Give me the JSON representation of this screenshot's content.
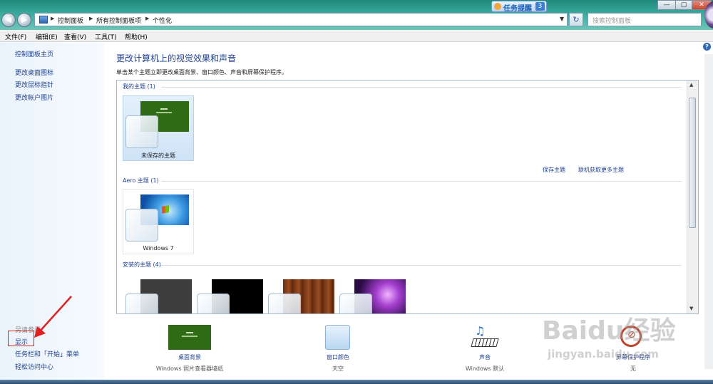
{
  "window": {
    "breadcrumbs": [
      "控制面板",
      "所有控制面板项",
      "个性化"
    ],
    "search_placeholder": "搜索控制面板",
    "task_notice": {
      "label": "任务提醒",
      "count": "3"
    }
  },
  "menubar": [
    "文件(F)",
    "编辑(E)",
    "查看(V)",
    "工具(T)",
    "帮助(H)"
  ],
  "sidebar": {
    "home": "控制面板主页",
    "links": [
      "更改桌面图标",
      "更改鼠标指针",
      "更改帐户图片"
    ],
    "see_also_title": "另请参阅",
    "see_also": [
      "显示",
      "任务栏和「开始」菜单",
      "轻松访问中心"
    ]
  },
  "main": {
    "heading": "更改计算机上的视觉效果和声音",
    "subheading": "单击某个主题立即更改桌面背景、窗口颜色、声音和屏幕保护程序。",
    "groups": {
      "my_themes": "我的主题 (1)",
      "aero_themes": "Aero 主题 (1)",
      "installed_themes": "安装的主题 (4)"
    },
    "unsaved_theme_label": "未保存的主题",
    "windows7_label": "Windows 7",
    "save_theme": "保存主题",
    "get_more_themes": "联机获取更多主题"
  },
  "bottom": [
    {
      "title": "桌面背景",
      "sub": "Windows 照片查看器墙纸"
    },
    {
      "title": "窗口颜色",
      "sub": "天空"
    },
    {
      "title": "声音",
      "sub": "Windows 默认"
    },
    {
      "title": "屏幕保护程序",
      "sub": "无"
    }
  ],
  "annotation": {
    "color": "#e02020"
  },
  "watermark": {
    "logo": "Baidu经验",
    "url": "jingyan.baidu.com"
  },
  "colors": {
    "link": "#1e3f91",
    "accent_green": "#2f6a14"
  }
}
